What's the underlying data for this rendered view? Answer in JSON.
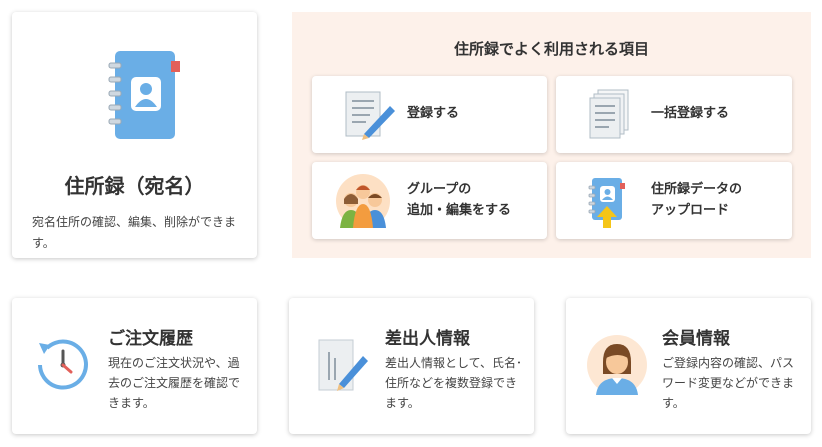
{
  "address_book": {
    "title": "住所録（宛名）",
    "description": "宛名住所の確認、編集、削除ができます。"
  },
  "frequent": {
    "title": "住所録でよく利用される項目",
    "items": [
      {
        "label": "登録する",
        "icon": "form-pen-icon"
      },
      {
        "label": "一括登録する",
        "icon": "stacked-documents-icon"
      },
      {
        "label": "グループの\n追加・編集をする",
        "icon": "group-people-icon"
      },
      {
        "label": "住所録データの\nアップロード",
        "icon": "address-book-upload-icon"
      }
    ]
  },
  "bottom_cards": [
    {
      "title": "ご注文履歴",
      "description": "現在のご注文状況や、過去のご注文履歴を確認できます。",
      "icon": "history-clock-icon"
    },
    {
      "title": "差出人情報",
      "description": "差出人情報として、氏名･住所などを複数登録できます。",
      "icon": "sender-pen-icon"
    },
    {
      "title": "会員情報",
      "description": "ご登録内容の確認、パスワード変更などができます。",
      "icon": "member-avatar-icon"
    }
  ],
  "colors": {
    "panel_bg": "#fdf1ea",
    "book_blue": "#6aaee6",
    "accent_red": "#e2605a",
    "accent_orange": "#f39c3f"
  }
}
